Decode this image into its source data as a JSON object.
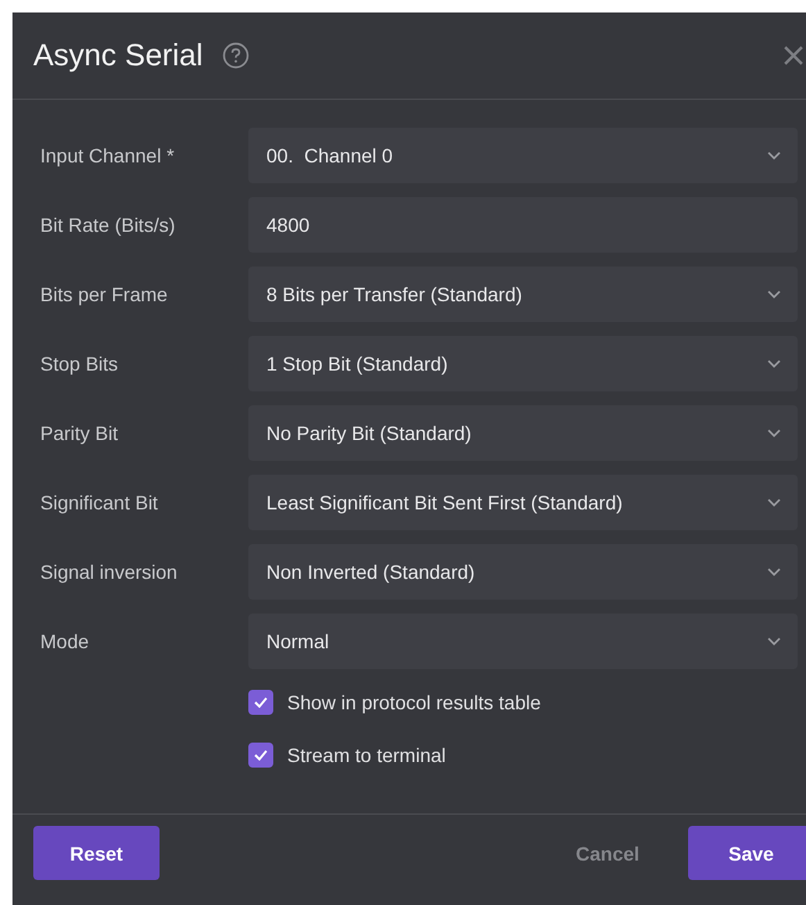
{
  "dialog": {
    "title": "Async Serial"
  },
  "fields": [
    {
      "label": "Input Channel *",
      "kind": "select",
      "value": "00.  Channel 0"
    },
    {
      "label": "Bit Rate (Bits/s)",
      "kind": "text",
      "value": "4800"
    },
    {
      "label": "Bits per Frame",
      "kind": "select",
      "value": "8 Bits per Transfer (Standard)"
    },
    {
      "label": "Stop Bits",
      "kind": "select",
      "value": "1 Stop Bit (Standard)"
    },
    {
      "label": "Parity Bit",
      "kind": "select",
      "value": "No Parity Bit (Standard)"
    },
    {
      "label": "Significant Bit",
      "kind": "select",
      "value": "Least Significant Bit Sent First (Standard)"
    },
    {
      "label": "Signal inversion",
      "kind": "select",
      "value": "Non Inverted (Standard)"
    },
    {
      "label": "Mode",
      "kind": "select",
      "value": "Normal"
    }
  ],
  "options": [
    {
      "label": "Show in protocol results table",
      "checked": true
    },
    {
      "label": "Stream to terminal",
      "checked": true
    }
  ],
  "buttons": {
    "reset": "Reset",
    "cancel": "Cancel",
    "save": "Save"
  }
}
